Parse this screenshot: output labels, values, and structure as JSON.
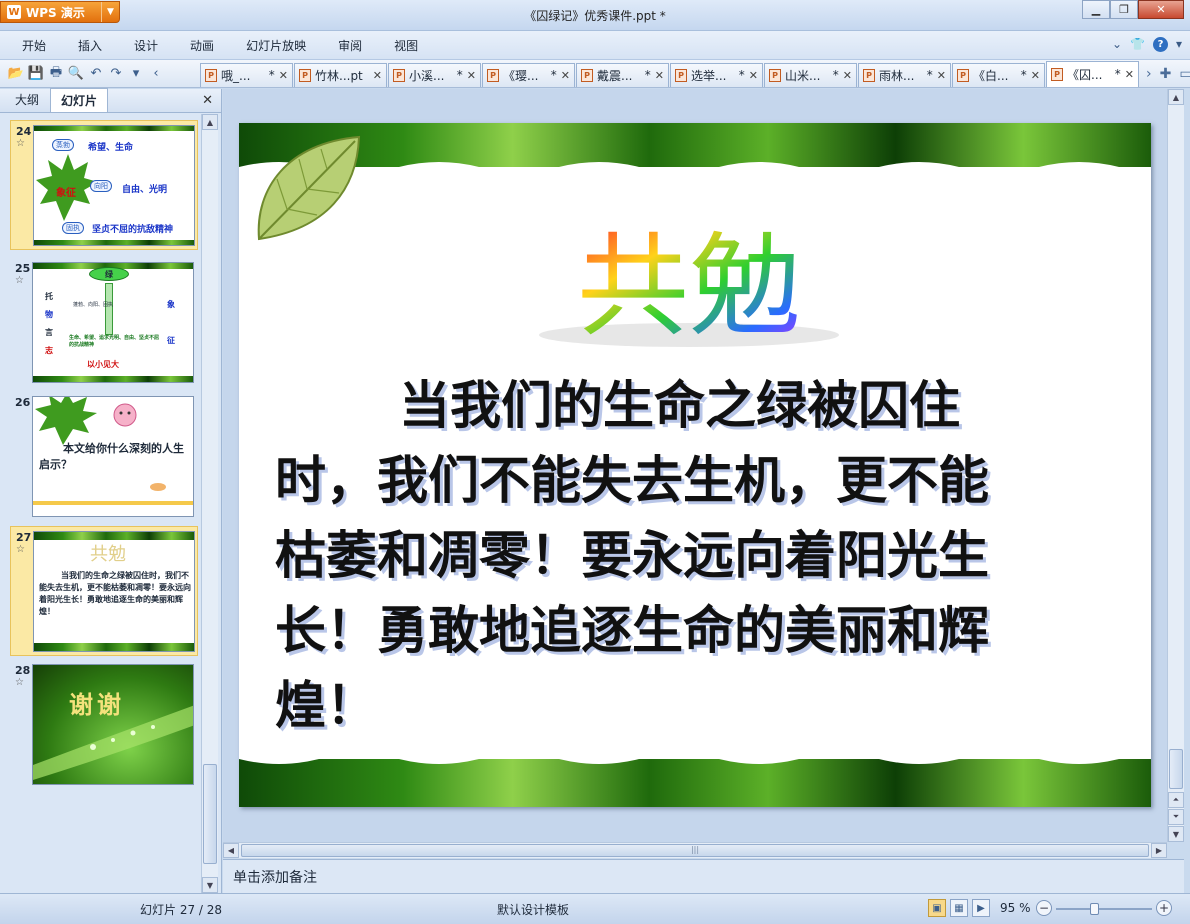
{
  "app": {
    "name": "WPS 演示",
    "window_title": "《囚绿记》优秀课件.ppt *"
  },
  "menu": [
    "开始",
    "插入",
    "设计",
    "动画",
    "幻灯片放映",
    "审阅",
    "视图"
  ],
  "doc_tabs": [
    {
      "label": "哦_...",
      "modified": "*"
    },
    {
      "label": "竹林...pt",
      "modified": ""
    },
    {
      "label": "小溪...",
      "modified": "*"
    },
    {
      "label": "《璎...",
      "modified": "*"
    },
    {
      "label": "戴震...",
      "modified": "*"
    },
    {
      "label": "选举...",
      "modified": "*"
    },
    {
      "label": "山米...",
      "modified": "*"
    },
    {
      "label": "雨林...",
      "modified": "*"
    },
    {
      "label": "《白...",
      "modified": "*"
    },
    {
      "label": "《囚...",
      "modified": "*"
    }
  ],
  "panel": {
    "tabs": [
      "大纲",
      "幻灯片"
    ],
    "active_tab": "幻灯片"
  },
  "thumbnails": {
    "slide24": {
      "num": "24",
      "tag1": "蒸勃",
      "line1": "希望、生命",
      "center": "象征",
      "tag2": "向阳",
      "line2": "自由、光明",
      "tag3": "固执",
      "line3": "坚贞不屈的抗敌精神"
    },
    "slide25": {
      "num": "25",
      "top": "绿",
      "left": [
        "托",
        "物",
        "言",
        "志"
      ],
      "mid1": "蓬勃、向阳、固执",
      "right1": "象",
      "mid2": "生命、希望、追求光明、自由、坚贞不屈的抗战精神",
      "right2": "征",
      "bottom": "以小见大"
    },
    "slide26": {
      "num": "26",
      "text": "本文给你什么深刻的人生启示？"
    },
    "slide27": {
      "num": "27",
      "title": "共勉",
      "text": "当我们的生命之绿被囚住时，我们不能失去生机，更不能枯萎和凋零！要永远向着阳光生长！勇敢地追逐生命的美丽和辉煌！"
    },
    "slide28": {
      "num": "28",
      "text": "谢谢"
    }
  },
  "slide": {
    "title": "共勉",
    "line1": "当我们的生命之绿被囚住",
    "line2": "时，我们不能失去生机，更不能",
    "line3": "枯萎和凋零！要永远向着阳光生",
    "line4": "长！勇敢地追逐生命的美丽和辉",
    "line5": "煌！"
  },
  "notes_placeholder": "单击添加备注",
  "status": {
    "slide_indicator": "幻灯片 27 / 28",
    "template": "默认设计模板",
    "zoom": "95 %",
    "zoom_fraction": 0.4
  },
  "colors": {
    "accent": "#e2700d",
    "slide_text": "#111111",
    "selected_thumb": "#fbe9a5",
    "leaf_green": "#2f8a14"
  }
}
